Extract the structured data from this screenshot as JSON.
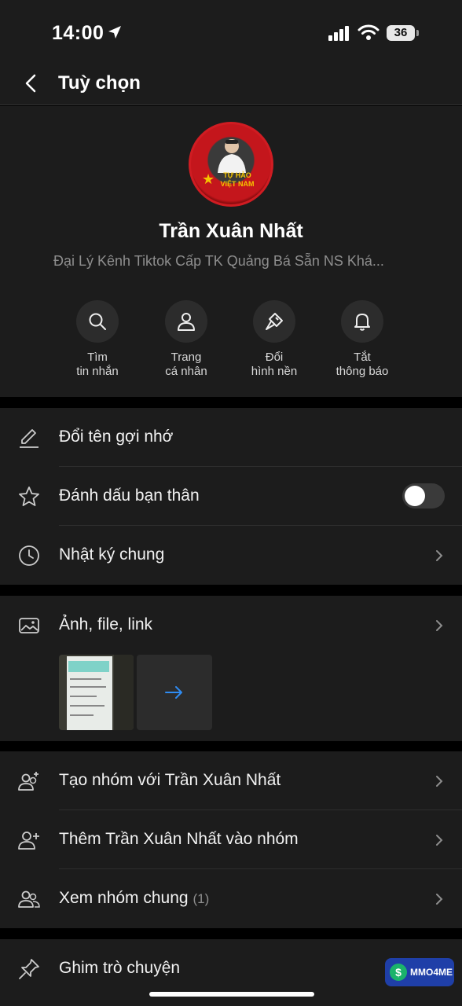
{
  "status_bar": {
    "time": "14:00",
    "battery": "36"
  },
  "header": {
    "title": "Tuỳ chọn"
  },
  "profile": {
    "avatar_text": "TỰ HÀO VIỆT NAM",
    "name": "Trần Xuân Nhất",
    "description": "Đại Lý Kênh Tiktok   Cấp TK Quảng Bá Sẵn NS  Khá..."
  },
  "actions": [
    {
      "label": "Tìm\ntin nhắn",
      "icon": "search-icon"
    },
    {
      "label": "Trang\ncá nhân",
      "icon": "person-icon"
    },
    {
      "label": "Đổi\nhình nền",
      "icon": "paintbrush-icon"
    },
    {
      "label": "Tắt\nthông báo",
      "icon": "bell-icon"
    }
  ],
  "section1": {
    "rename": "Đổi tên gợi nhớ",
    "best_friend": "Đánh dấu bạn thân",
    "best_friend_on": false,
    "journal": "Nhật ký chung"
  },
  "media": {
    "label": "Ảnh, file, link"
  },
  "groups": {
    "create": "Tạo nhóm với Trần Xuân Nhất",
    "add": "Thêm Trần Xuân Nhất vào nhóm",
    "common": "Xem nhóm chung",
    "common_count": "(1)"
  },
  "pin": {
    "label": "Ghim trò chuyện"
  },
  "watermark": {
    "text": "MMO4ME"
  },
  "colors": {
    "background": "#1c1c1c",
    "accent_arrow": "#2f8cf2",
    "muted": "#8e8e8e"
  }
}
